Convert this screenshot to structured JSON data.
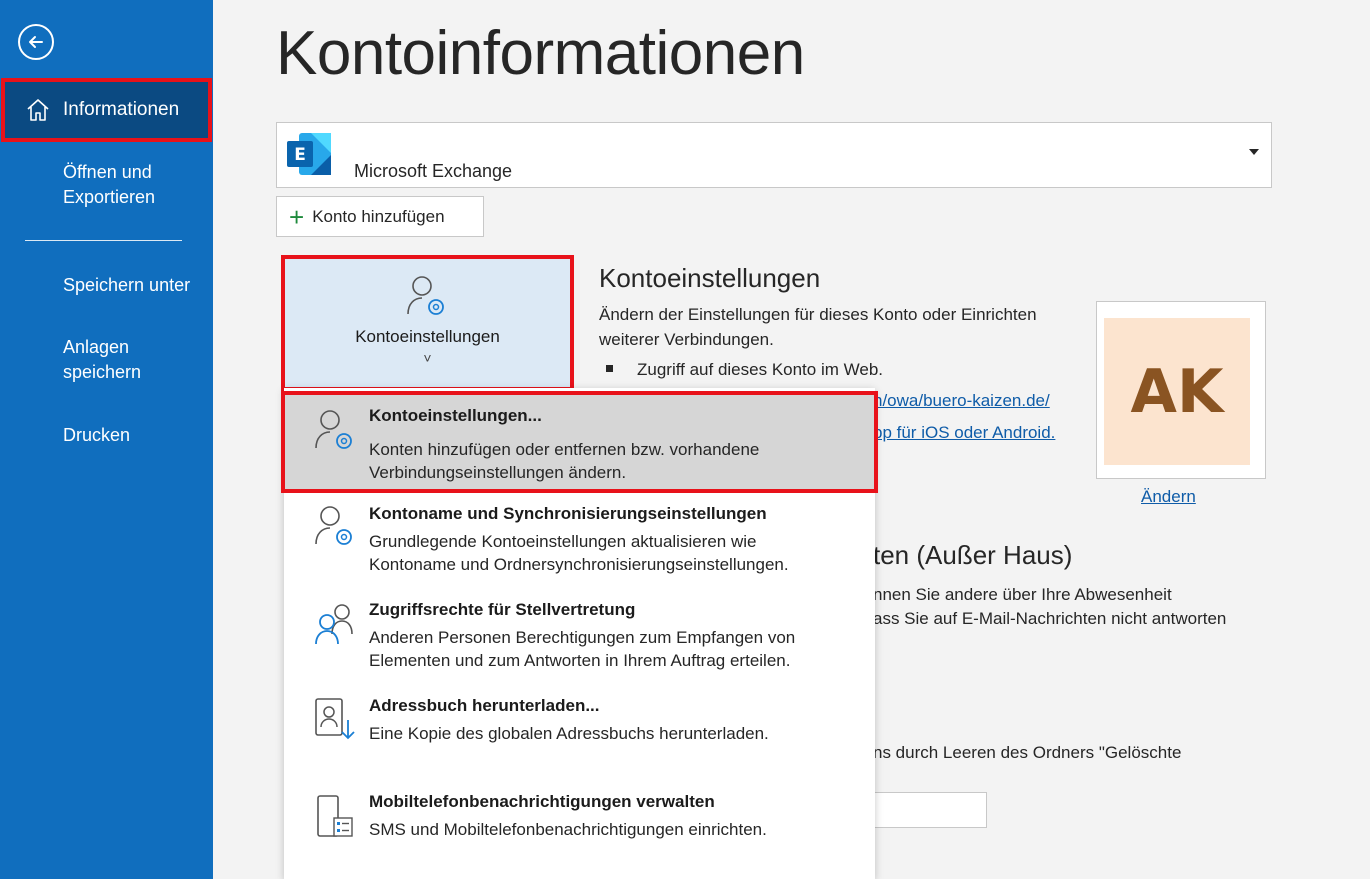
{
  "sidebar": {
    "items": [
      {
        "label": "Informationen"
      },
      {
        "label": "Öffnen und Exportieren"
      },
      {
        "label": "Speichern unter"
      },
      {
        "label": "Anlagen speichern"
      },
      {
        "label": "Drucken"
      }
    ],
    "open_line1": "Öffnen und",
    "open_line2": "Exportieren",
    "attach_line1": "Anlagen",
    "attach_line2": "speichern"
  },
  "page_title": "Kontoinformationen",
  "account": {
    "name": "Microsoft Exchange",
    "add_label": "Konto hinzufügen"
  },
  "account_settings_tile": {
    "label": "Kontoeinstellungen",
    "chevron": "˅"
  },
  "settings_section": {
    "title": "Kontoeinstellungen",
    "desc_line1": "Ändern der Einstellungen für dieses Konto oder Einrichten",
    "desc_line2": "weiterer Verbindungen.",
    "bullet": "Zugriff auf dieses Konto im Web.",
    "link1_partial": "n/owa/buero-kaizen.de/",
    "link2_partial": "pp für iOS oder Android."
  },
  "avatar": {
    "initials": "AK",
    "change_label": "Ändern"
  },
  "auto_reply": {
    "title_partial": "ten (Außer Haus)",
    "line1_partial": "nnen Sie andere über Ihre Abwesenheit",
    "line2_partial": "ass Sie auf E-Mail-Nachrichten nicht antworten"
  },
  "cleanup": {
    "line_partial": "ns durch Leeren des Ordners \"Gelöschte"
  },
  "menu": {
    "items": [
      {
        "title": "Kontoeinstellungen...",
        "desc1": "Konten hinzufügen oder entfernen bzw. vorhandene",
        "desc2": "Verbindungseinstellungen ändern.",
        "icon": "user-gear-icon"
      },
      {
        "title": "Kontoname und Synchronisierungseinstellungen",
        "desc1": "Grundlegende Kontoeinstellungen aktualisieren wie",
        "desc2": "Kontoname und Ordnersynchronisierungseinstellungen.",
        "icon": "user-gear-icon"
      },
      {
        "title": "Zugriffsrechte für Stellvertretung",
        "desc1": "Anderen Personen Berechtigungen zum Empfangen von",
        "desc2": "Elementen und zum Antworten in Ihrem Auftrag erteilen.",
        "icon": "delegate-users-icon"
      },
      {
        "title": "Adressbuch herunterladen...",
        "desc1": "Eine Kopie des globalen Adressbuchs herunterladen.",
        "desc2": "",
        "icon": "address-book-download-icon"
      },
      {
        "title": "Mobiltelefonbenachrichtigungen verwalten",
        "desc1": "SMS und Mobiltelefonbenachrichtigungen einrichten.",
        "desc2": "",
        "icon": "mobile-notification-icon"
      }
    ]
  },
  "colors": {
    "sidebar": "#106ebe",
    "sidebar_selected": "#0b4a82",
    "highlight_border": "#e8121a",
    "link": "#0f5ca8",
    "avatar_bg": "#fce4cf",
    "avatar_text": "#8a5422"
  }
}
